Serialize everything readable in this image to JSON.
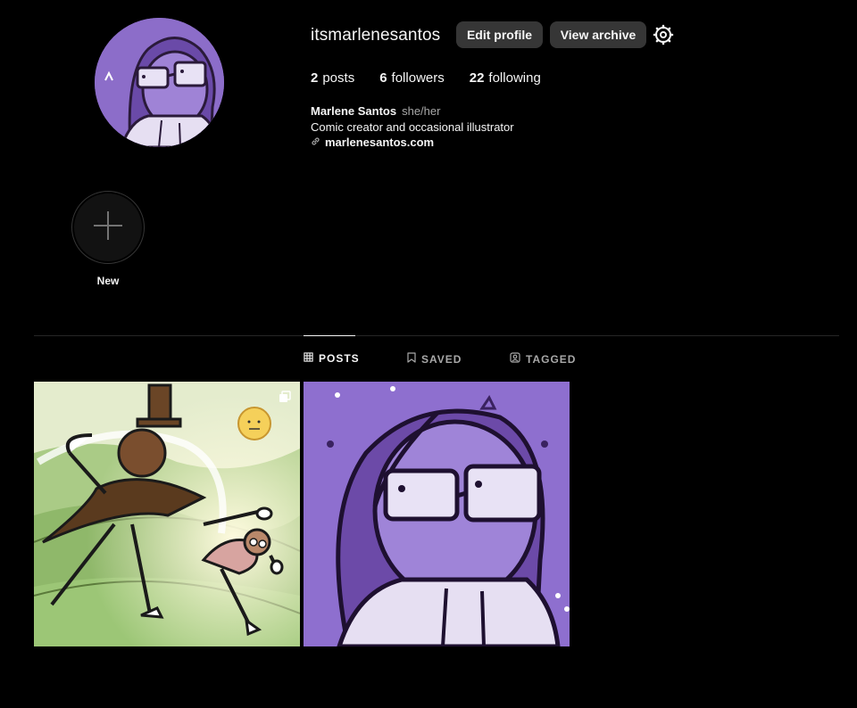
{
  "profile": {
    "username": "itsmarlenesantos",
    "edit_label": "Edit profile",
    "archive_label": "View archive",
    "settings_icon": "gear-icon",
    "avatar_icon": "avatar"
  },
  "stats": {
    "posts_count": "2",
    "posts_label": "posts",
    "followers_count": "6",
    "followers_label": "followers",
    "following_count": "22",
    "following_label": "following"
  },
  "bio": {
    "name": "Marlene Santos",
    "pronouns": "she/her",
    "description": "Comic creator and occasional illustrator",
    "link": "marlenesantos.com",
    "link_icon": "link-icon"
  },
  "highlights": {
    "new_label": "New",
    "new_icon": "plus-icon"
  },
  "tabs": [
    {
      "label": "POSTS",
      "icon": "grid-icon",
      "active": true
    },
    {
      "label": "SAVED",
      "icon": "bookmark-icon",
      "active": false
    },
    {
      "label": "TAGGED",
      "icon": "tagged-icon",
      "active": false
    }
  ],
  "posts": [
    {
      "name": "post-comic-hat-character",
      "multi": true
    },
    {
      "name": "post-self-portrait",
      "multi": false
    }
  ],
  "colors": {
    "background": "#000000",
    "button": "#363636",
    "text_primary": "#f5f5f5",
    "text_secondary": "#a8a8a8",
    "divider": "#262626",
    "avatar_purple": "#8c6dc9"
  }
}
